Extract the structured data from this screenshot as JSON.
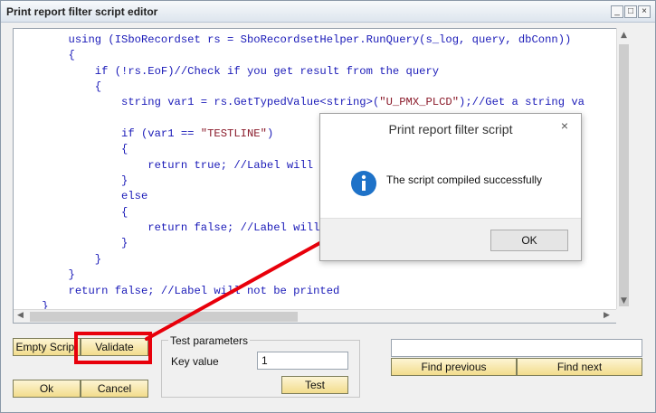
{
  "window": {
    "title": "Print report filter script editor",
    "minimize_glyph": "_",
    "maximize_glyph": "□",
    "close_glyph": "×"
  },
  "editor": {
    "code_lines": [
      "        using (ISboRecordset rs = SboRecordsetHelper.RunQuery(s_log, query, dbConn))",
      "        {",
      "            if (!rs.EoF)//Check if you get result from the query",
      "            {",
      "                string var1 = rs.GetTypedValue<string>(\"U_PMX_PLCD\");//Get a string va",
      "",
      "                if (var1 == \"TESTLINE\")",
      "                {",
      "                    return true; //Label will be printed",
      "                }",
      "                else",
      "                {",
      "                    return false; //Label will not be printed",
      "                }",
      "            }",
      "        }",
      "        return false; //Label will not be printed",
      "    }",
      "}"
    ]
  },
  "buttons": {
    "empty_script": "Empty Script",
    "validate": "Validate",
    "ok": "Ok",
    "cancel": "Cancel",
    "test": "Test",
    "find_previous": "Find previous",
    "find_next": "Find next"
  },
  "test_parameters": {
    "group_label": "Test parameters",
    "key_label": "Key value",
    "key_value": "1"
  },
  "search": {
    "value": ""
  },
  "dialog": {
    "title": "Print report filter script",
    "close_glyph": "×",
    "message": "The script compiled successfully",
    "ok_label": "OK"
  },
  "colors": {
    "annotation_red": "#e8000b",
    "code_blue": "#1a1ab8",
    "button_gold": "#f2dc8c",
    "info_blue": "#1e72c8"
  }
}
